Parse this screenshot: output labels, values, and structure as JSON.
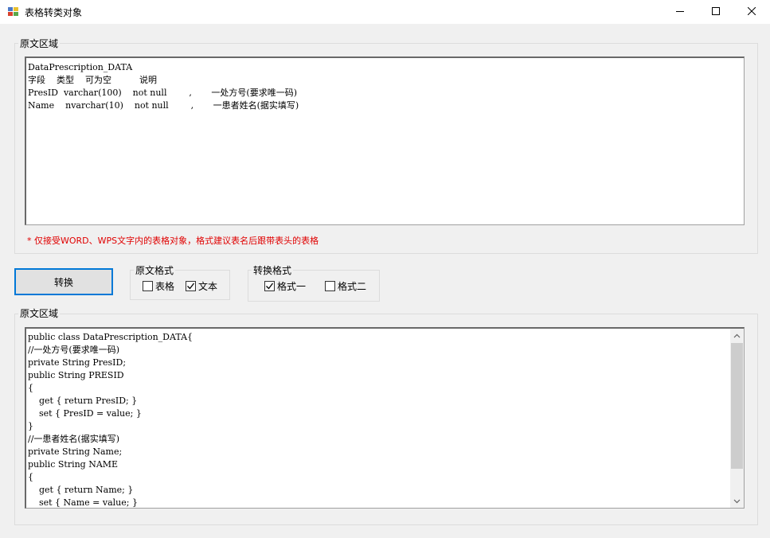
{
  "window": {
    "title": "表格转类对象",
    "icon": "app-table-icon",
    "controls": [
      "minimize-icon",
      "maximize-icon",
      "close-icon"
    ]
  },
  "source_group": {
    "label": "原文区域",
    "text": "DataPrescription_DATA\n字段    类型    可为空          说明\nPresID  varchar(100)    not null        ,       一处方号(要求唯一码)\nName    nvarchar(10)    not null        ,       一患者姓名(据实填写)",
    "hint": "* 仅接受WORD、WPS文字内的表格对象，格式建议表名后跟带表头的表格"
  },
  "convert_button": {
    "label": "转换"
  },
  "source_format": {
    "label": "原文格式",
    "options": [
      {
        "label": "表格",
        "checked": false
      },
      {
        "label": "文本",
        "checked": true
      }
    ]
  },
  "convert_format": {
    "label": "转换格式",
    "options": [
      {
        "label": "格式一",
        "checked": true
      },
      {
        "label": "格式二",
        "checked": false
      }
    ]
  },
  "output_group": {
    "label": "原文区域",
    "text": "public class DataPrescription_DATA{\n//一处方号(要求唯一码)\nprivate String PresID;\npublic String PRESID\n{\n    get { return PresID; }\n    set { PresID = value; }\n}\n//一患者姓名(据实填写)\nprivate String Name;\npublic String NAME\n{\n    get { return Name; }\n    set { Name = value; }"
  },
  "colors": {
    "window_bg": "#f0f0f0",
    "hint_red": "#e00000",
    "button_focus_border": "#0078d7"
  }
}
